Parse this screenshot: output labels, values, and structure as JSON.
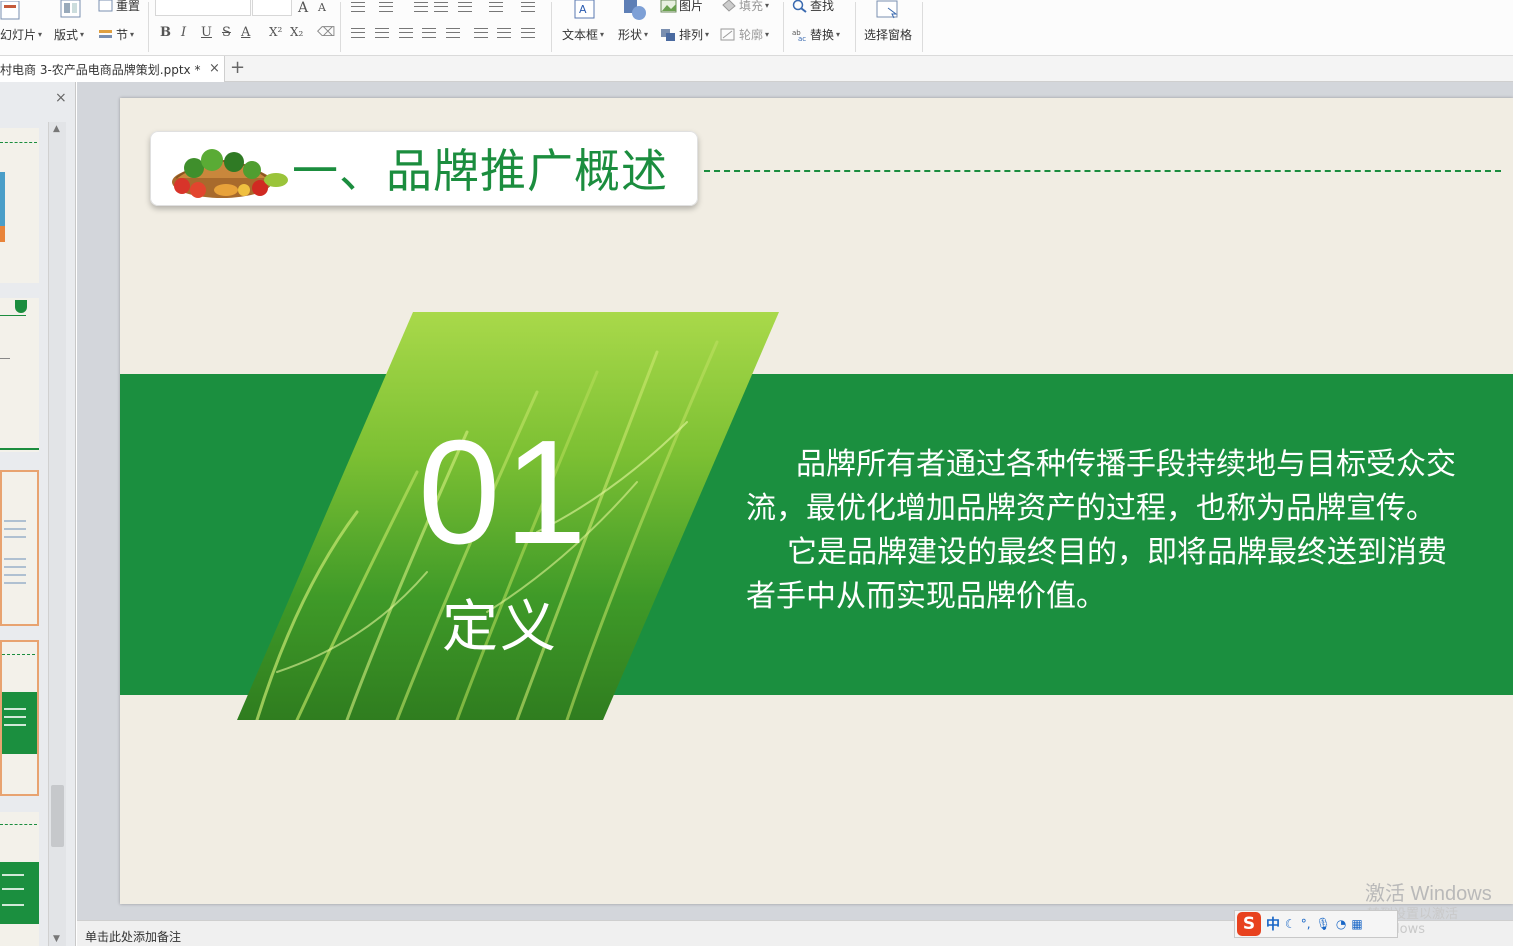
{
  "ribbon": {
    "new_slide": "幻灯片",
    "reset": "重置",
    "layout": "版式",
    "section": "节",
    "textbox": "文本框",
    "shape": "形状",
    "picture": "图片",
    "fill": "填充",
    "arrange": "排列",
    "outline": "轮廓",
    "find": "查找",
    "replace": "替换",
    "selection_pane": "选择窗格",
    "format_bold": "B",
    "format_italic": "I",
    "format_underline": "U",
    "format_strike": "S",
    "font_color": "A",
    "superscript": "X²",
    "subscript": "X₂",
    "grow_font": "A",
    "shrink_font": "A"
  },
  "document": {
    "tab_name": "村电商 3-农产品电商品牌策划.pptx *",
    "close_label": "×",
    "new_tab_label": "+"
  },
  "panel": {
    "close_label": "×"
  },
  "slide": {
    "title": "一、品牌推广概述",
    "number": "01",
    "heading": "定义",
    "para1_line1": "品牌所有者通过各种传播手段持续地与目标受众交",
    "para1_line2": "流，最优化增加品牌资产的过程，也称为品牌宣传。",
    "para2_line1": "它是品牌建设的最终目的，即将品牌最终送到消费",
    "para2_line2": "者手中从而实现品牌价值。",
    "colors": {
      "band": "#1b8f3f",
      "title": "#1b8d3e",
      "background": "#f1ede3"
    }
  },
  "status": {
    "notes_placeholder": "单击此处添加备注",
    "windows_watermark": "激活 Windows",
    "windows_watermark_sub": "转到设置以激活 Windows",
    "ime_s": "S",
    "ime_lang": "中"
  }
}
